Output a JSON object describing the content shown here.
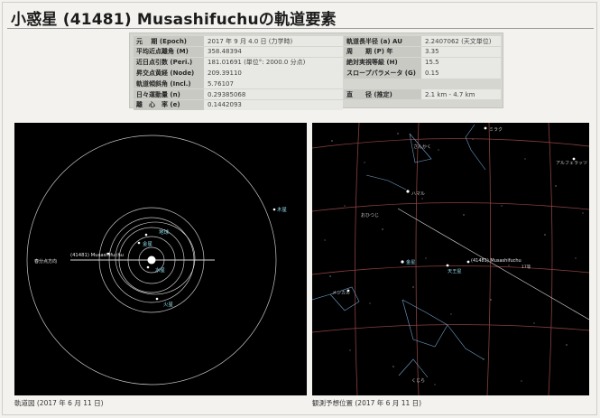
{
  "title": "小惑星 (41481) Musashifuchuの軌道要素",
  "elements_left": [
    {
      "label": "元　 期 (Epoch)",
      "value": "2017 年 9 月 4.0 日 (力学時)"
    },
    {
      "label": "平均近点離角 (M)",
      "value": "358.48394"
    },
    {
      "label": "近日点引数 (Peri.)",
      "value": "181.01691 (単位°: 2000.0 分点)"
    },
    {
      "label": "昇交点黄経 (Node)",
      "value": "209.39110"
    },
    {
      "label": "軌道傾斜角 (Incl.)",
      "value": "5.76107"
    },
    {
      "label": "日々運動量 (n)",
      "value": "0.29385068"
    },
    {
      "label": "離　心　率 (e)",
      "value": "0.1442093"
    }
  ],
  "elements_right": [
    {
      "label": "軌道長半径 (a) AU",
      "value": "2.2407062 (天文単位)"
    },
    {
      "label": "周　　期 (P) 年",
      "value": "3.35"
    },
    {
      "label": "絶対実視等級 (H)",
      "value": "15.5"
    },
    {
      "label": "スロープパラメータ (G)",
      "value": "0.15"
    },
    {
      "label": "直　　径 (推定)",
      "value": "2.1 km - 4.7 km"
    }
  ],
  "orbit_chart": {
    "caption": "軌道図 (2017 年 6 月 11 日)",
    "labels": {
      "jupiter": "木星",
      "earth": "地球",
      "venus": "金星",
      "mercury": "水星",
      "mars": "火星",
      "asteroid": "(41481) Musashifuchu",
      "vernal": "春分点方向"
    }
  },
  "sky_chart": {
    "caption": "観測予想位置 (2017 年 6 月 11 日)",
    "labels": {
      "miraku": "ミラク",
      "sankaku": "さんかく",
      "alpheratz": "アルフェラッツ",
      "hamal": "ハマル",
      "ohitsuji": "おひつじ",
      "uranus": "天王星",
      "venus": "金星",
      "menkar": "メンカル",
      "kujira": "くじら",
      "asteroid": "(41481) Musashifuchu",
      "mag": "17等"
    }
  },
  "colors": {
    "orbit_line": "#c8c8c8",
    "planet_label": "#8fd8e8",
    "ecliptic": "#e09090",
    "constellation": "#6fa0c8",
    "sky_label": "#c8c8c8"
  }
}
